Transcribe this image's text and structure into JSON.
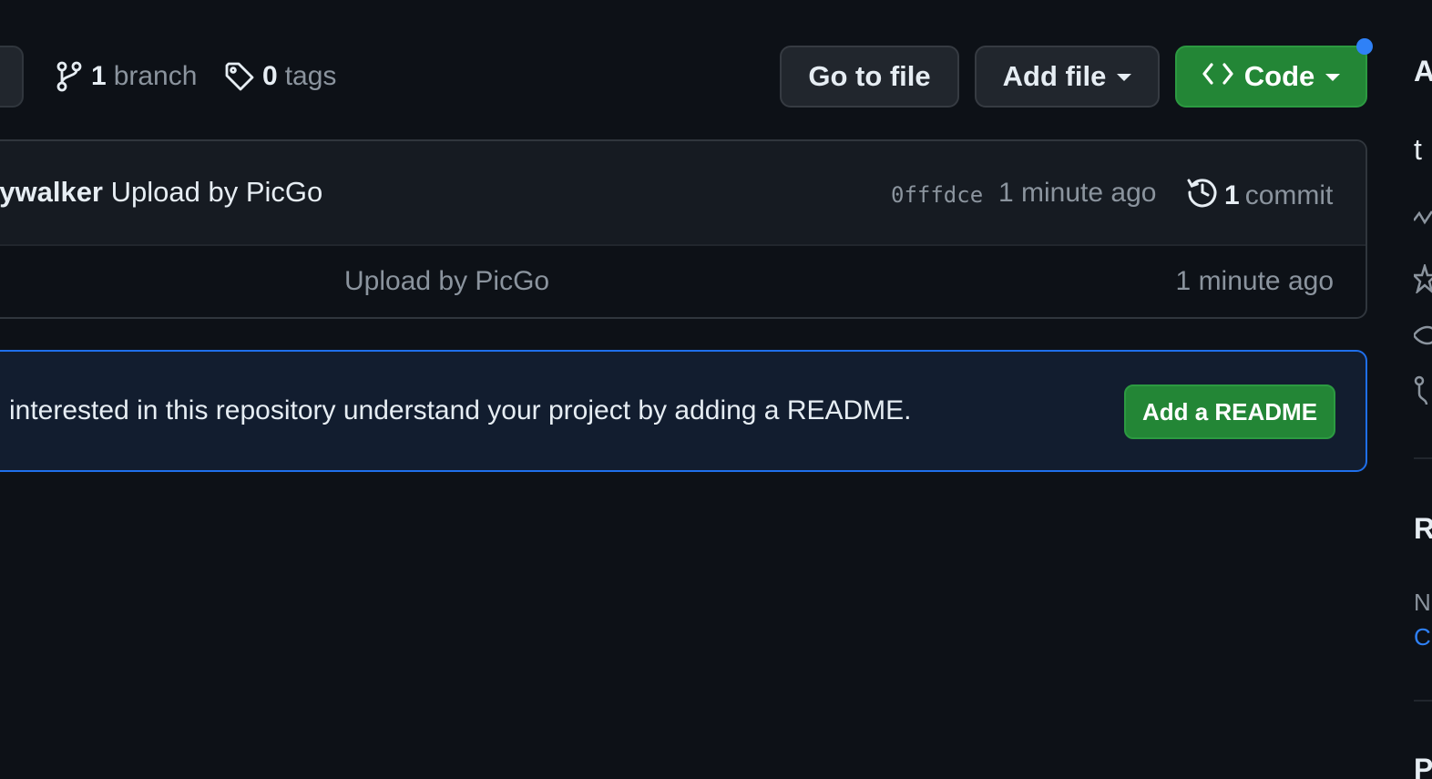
{
  "toolbar": {
    "branch_count": "1",
    "branch_label": "branch",
    "tag_count": "0",
    "tag_label": "tags",
    "go_to_file": "Go to file",
    "add_file": "Add file",
    "code": "Code"
  },
  "latest_commit": {
    "author": "kywalker",
    "message": "Upload by PicGo",
    "sha": "0fffdce",
    "time": "1 minute ago",
    "count": "1",
    "count_label": "commit"
  },
  "files": [
    {
      "message": "Upload by PicGo",
      "time": "1 minute ago"
    }
  ],
  "readme_banner": {
    "text": "interested in this repository understand your project by adding a README.",
    "button": "Add a README"
  },
  "sidebar": {
    "about_heading_fragment": "A",
    "description_fragment": "t",
    "releases_heading_fragment": "R",
    "releases_text_fragment": "N",
    "releases_link_fragment": "C",
    "packages_heading_fragment": "P"
  },
  "colors": {
    "background": "#0d1117",
    "primary_button": "#238636",
    "accent_blue": "#2f81f7",
    "border": "#30363d"
  }
}
